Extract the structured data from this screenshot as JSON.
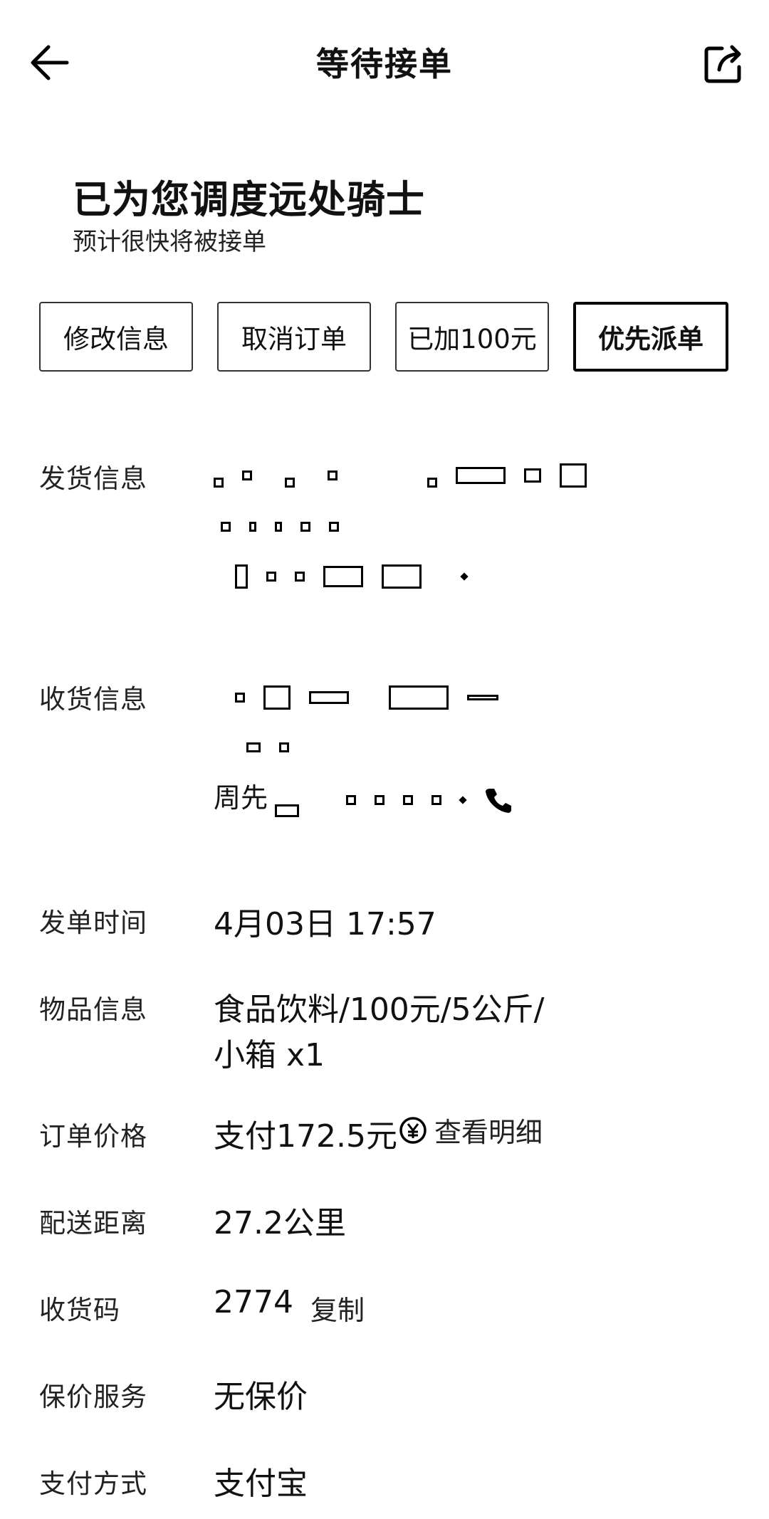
{
  "header": {
    "title": "等待接单",
    "back_icon": "arrow-left-icon",
    "share_icon": "share-icon"
  },
  "status": {
    "title": "已为您调度远处骑士",
    "subtitle": "预计很快将被接单"
  },
  "actions": [
    {
      "label": "修改信息"
    },
    {
      "label": "取消订单"
    },
    {
      "label": "已加100元"
    },
    {
      "label": "优先派单"
    }
  ],
  "info": {
    "sender": {
      "label": "发货信息"
    },
    "receiver": {
      "label": "收货信息",
      "contact_prefix": "周先"
    },
    "order_time": {
      "label": "发单时间",
      "value": "4月03日 17:57"
    },
    "goods": {
      "label": "物品信息",
      "value_line1": "食品饮料/100元/5公斤/",
      "value_line2": "小箱 x1"
    },
    "price": {
      "label": "订单价格",
      "value": "支付172.5元",
      "detail_label": "查看明细"
    },
    "distance": {
      "label": "配送距离",
      "value": "27.2公里"
    },
    "code": {
      "label": "收货码",
      "value": "2774",
      "copy_label": "复制"
    },
    "insurance": {
      "label": "保价服务",
      "value": "无保价"
    },
    "payment": {
      "label": "支付方式",
      "value": "支付宝"
    }
  }
}
